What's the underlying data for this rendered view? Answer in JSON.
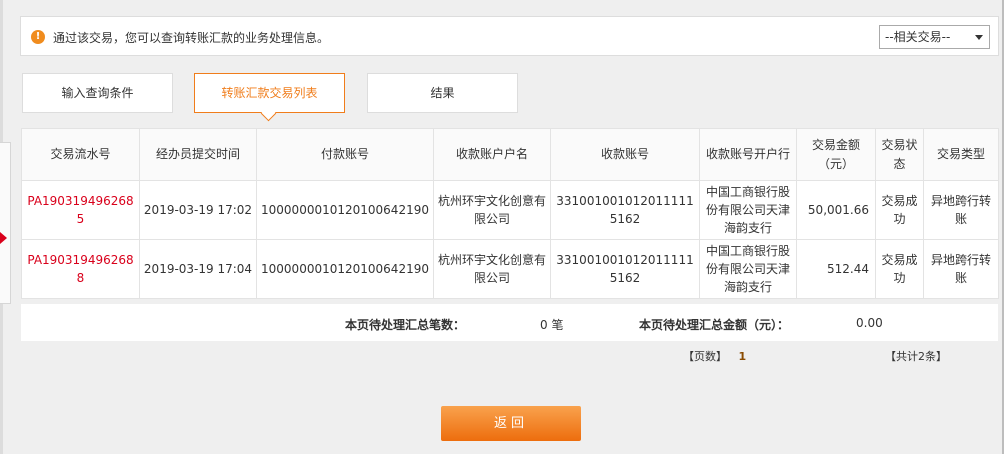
{
  "notice": {
    "text": "通过该交易，您可以查询转账汇款的业务处理信息。",
    "related_select": "--相关交易--"
  },
  "tabs": [
    {
      "label": "输入查询条件",
      "active": false
    },
    {
      "label": "转账汇款交易列表",
      "active": true
    },
    {
      "label": "结果",
      "active": false
    }
  ],
  "table": {
    "headers": [
      "交易流水号",
      "经办员提交时间",
      "付款账号",
      "收款账户户名",
      "收款账号",
      "收款账号开户行",
      "交易金额（元）",
      "交易状态",
      "交易类型"
    ],
    "rows": [
      [
        "PA1903194962685",
        "2019-03-19 17:02",
        "100000001012010064219​0",
        "杭州环宇文化创意有限公司",
        "331001001012011111516​2",
        "中国工商银行股份有限公司天津海韵支行",
        "50,001.66",
        "交易成功",
        "异地跨行转账"
      ],
      [
        "PA1903194962688",
        "2019-03-19 17:04",
        "100000001012010064219​0",
        "杭州环宇文化创意有限公司",
        "331001001012011111516​2",
        "中国工商银行股份有限公司天津海韵支行",
        "512.44",
        "交易成功",
        "异地跨行转账"
      ]
    ]
  },
  "summary": {
    "count_label": "本页待处理汇总笔数：",
    "count_value": "0 笔",
    "amount_label": "本页待处理汇总金额（元）：",
    "amount_value": "0.00"
  },
  "pager": {
    "pages_label": "【页数】",
    "page_num": "1",
    "total": "【共计2条】"
  },
  "back_button": "返回",
  "colors": {
    "accent": "#f07d1b",
    "serial": "#d9001b"
  }
}
